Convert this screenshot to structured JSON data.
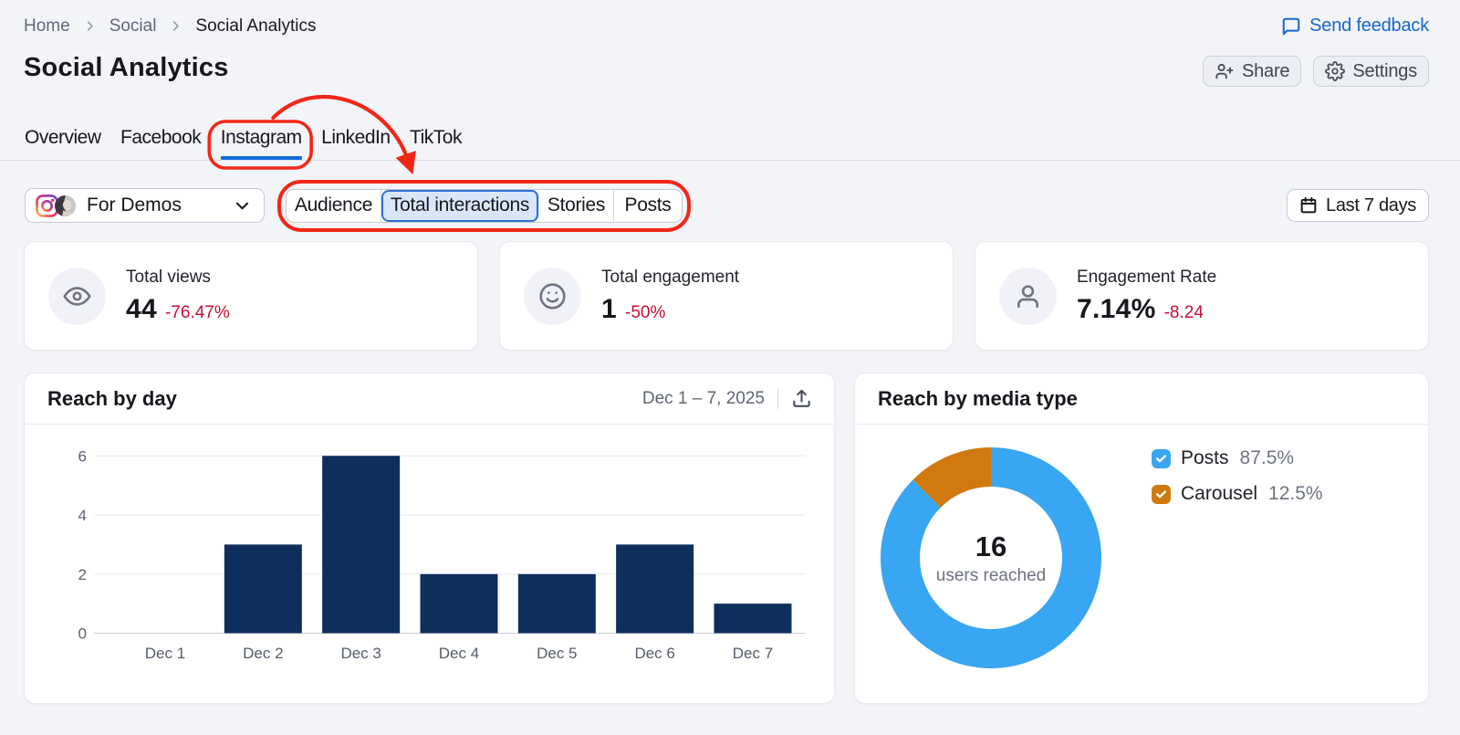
{
  "breadcrumb": {
    "items": [
      "Home",
      "Social",
      "Social Analytics"
    ]
  },
  "feedback_link": "Send feedback",
  "page_title": "Social Analytics",
  "actions": {
    "share": "Share",
    "settings": "Settings"
  },
  "tabs": [
    {
      "label": "Overview",
      "active": false
    },
    {
      "label": "Facebook",
      "active": false
    },
    {
      "label": "Instagram",
      "active": true
    },
    {
      "label": "LinkedIn",
      "active": false
    },
    {
      "label": "TikTok",
      "active": false
    }
  ],
  "account_selector": {
    "name": "For Demos",
    "network": "instagram"
  },
  "view_switcher": {
    "options": [
      "Audience",
      "Total interactions",
      "Stories",
      "Posts"
    ],
    "selected": "Total interactions"
  },
  "date_range_button": "Last 7 days",
  "metrics": [
    {
      "label": "Total views",
      "value": "44",
      "change": "-76.47%",
      "icon": "eye-icon"
    },
    {
      "label": "Total engagement",
      "value": "1",
      "change": "-50%",
      "icon": "smile-icon"
    },
    {
      "label": "Engagement Rate",
      "value": "7.14%",
      "change": "-8.24",
      "icon": "person-icon"
    }
  ],
  "chart_data": [
    {
      "type": "bar",
      "title": "Reach by day",
      "date_range": "Dec 1 – 7, 2025",
      "categories": [
        "Dec 1",
        "Dec 2",
        "Dec 3",
        "Dec 4",
        "Dec 5",
        "Dec 6",
        "Dec 7"
      ],
      "values": [
        0,
        3,
        6,
        2,
        2,
        3,
        1
      ],
      "xlabel": "",
      "ylabel": "",
      "ylim": [
        0,
        6
      ],
      "yticks": [
        0,
        2,
        4,
        6
      ],
      "grid": true,
      "bar_color": "#0e2f5c"
    },
    {
      "type": "donut",
      "title": "Reach by media type",
      "center_value": "16",
      "center_label": "users reached",
      "legend_position": "right",
      "slices": [
        {
          "name": "Posts",
          "value": 87.5,
          "label": "87.5%",
          "color": "#38a6f2",
          "checked": true
        },
        {
          "name": "Carousel",
          "value": 12.5,
          "label": "12.5%",
          "color": "#d0790f",
          "checked": true
        }
      ]
    }
  ],
  "annotation": {
    "color": "#f22718"
  },
  "colors": {
    "background": "#f3f4f8",
    "card": "#ffffff",
    "accent_blue": "#136bd8",
    "link_blue": "#1467cc",
    "negative_red": "#c90d33",
    "bar_navy": "#0e2f5c",
    "donut_blue": "#38a6f2",
    "donut_orange": "#d0790f",
    "annotation_red": "#f22718"
  }
}
